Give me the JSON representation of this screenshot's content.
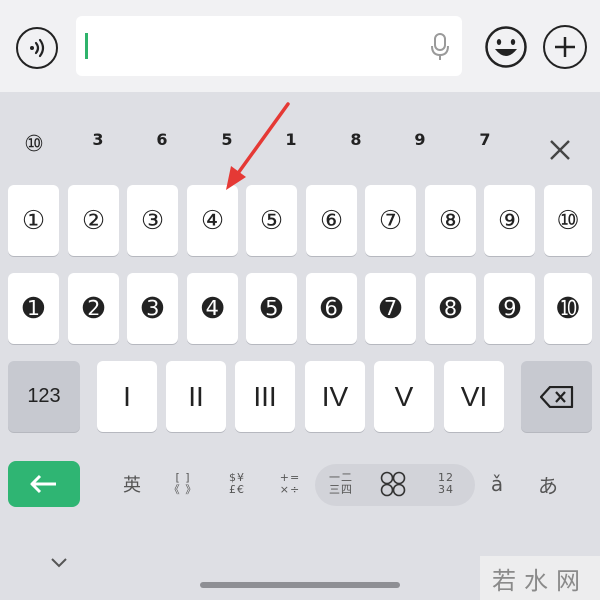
{
  "input": {
    "value": ""
  },
  "candidates": [
    "⑩",
    "3",
    "6",
    "5",
    "1",
    "8",
    "9",
    "7"
  ],
  "keys": {
    "row1": [
      "①",
      "②",
      "③",
      "④",
      "⑤",
      "⑥",
      "⑦",
      "⑧",
      "⑨",
      "⑩"
    ],
    "row2": [
      "➊",
      "➋",
      "➌",
      "➍",
      "➎",
      "➏",
      "➐",
      "➑",
      "➒",
      "➓"
    ],
    "row3_left": "123",
    "row3_roman": [
      "I",
      "II",
      "III",
      "IV",
      "V",
      "VI"
    ]
  },
  "toolbar": {
    "chinese": "英",
    "brackets_top": "[ ]",
    "brackets_bottom": "《 》",
    "currency_top": "$¥",
    "currency_bottom": "£€",
    "math_top": "+=",
    "math_bottom": "×÷",
    "numerals_top": "一二",
    "numerals_bottom": "三四",
    "circled": "88",
    "digits_top": "12",
    "digits_bottom": "34",
    "pinyin": "ǎ",
    "kana": "あ"
  },
  "watermark": "若水网",
  "colors": {
    "accent": "#2fb573",
    "arrow": "#e53935"
  }
}
